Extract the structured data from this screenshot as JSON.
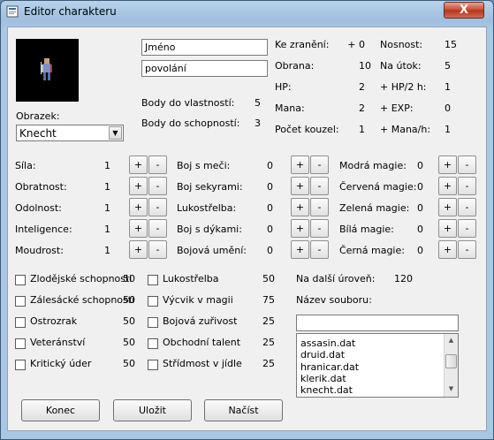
{
  "window": {
    "title": "Editor charakteru",
    "close_label": "X"
  },
  "portrait": {
    "label": "Obrazek:",
    "selected": "Knecht"
  },
  "identity": {
    "name": "Jméno",
    "profession": "povolání"
  },
  "points": [
    {
      "label": "Body do vlastností:",
      "value": "5"
    },
    {
      "label": "Body do schopností:",
      "value": "3"
    }
  ],
  "stats_left": [
    {
      "label": "Ke zranění:",
      "value": "+ 0"
    },
    {
      "label": "Obrana:",
      "value": "10"
    },
    {
      "label": "HP:",
      "value": "2"
    },
    {
      "label": "Mana:",
      "value": "2"
    },
    {
      "label": "Počet kouzel:",
      "value": "1"
    }
  ],
  "stats_right": [
    {
      "label": "Nosnost:",
      "value": "15"
    },
    {
      "label": "Na útok:",
      "value": "5"
    },
    {
      "label": "+ HP/2 h:",
      "value": "1"
    },
    {
      "label": "+ EXP:",
      "value": "0"
    },
    {
      "label": "+ Mana/h:",
      "value": "1"
    }
  ],
  "attributes": [
    {
      "label": "Síla:",
      "value": "1"
    },
    {
      "label": "Obratnost:",
      "value": "1"
    },
    {
      "label": "Odolnost:",
      "value": "1"
    },
    {
      "label": "Inteligence:",
      "value": "1"
    },
    {
      "label": "Moudrost:",
      "value": "1"
    }
  ],
  "combat": [
    {
      "label": "Boj s meči:",
      "value": "0"
    },
    {
      "label": "Boj sekyrami:",
      "value": "0"
    },
    {
      "label": "Lukostřelba:",
      "value": "0"
    },
    {
      "label": "Boj s dýkami:",
      "value": "0"
    },
    {
      "label": "Bojová umění:",
      "value": "0"
    }
  ],
  "magic": [
    {
      "label": "Modrá magie:",
      "value": "0"
    },
    {
      "label": "Červená magie:",
      "value": "0"
    },
    {
      "label": "Zelená magie:",
      "value": "0"
    },
    {
      "label": "Bílá magie:",
      "value": "0"
    },
    {
      "label": "Černá magie:",
      "value": "0"
    }
  ],
  "buttons": {
    "plus": "+",
    "minus": "-"
  },
  "skills_left": [
    {
      "label": "Zlodějské schopnosti",
      "cost": "50"
    },
    {
      "label": "Zálesácké schopnosti",
      "cost": "50"
    },
    {
      "label": "Ostrozrak",
      "cost": "50"
    },
    {
      "label": "Veteránství",
      "cost": "50"
    },
    {
      "label": "Kritický úder",
      "cost": "50"
    }
  ],
  "skills_right": [
    {
      "label": "Lukostřelba",
      "cost": "50"
    },
    {
      "label": "Výcvik v magii",
      "cost": "75"
    },
    {
      "label": "Bojová zuřivost",
      "cost": "25"
    },
    {
      "label": "Obchodní talent",
      "cost": "25"
    },
    {
      "label": "Střídmost v jídle",
      "cost": "25"
    }
  ],
  "level": {
    "label": "Na další úroveň:",
    "value": "120"
  },
  "file": {
    "label": "Název souboru:",
    "value": "",
    "list": [
      "assasin.dat",
      "druid.dat",
      "hranicar.dat",
      "klerik.dat",
      "knecht.dat"
    ]
  },
  "actions": {
    "end": "Konec",
    "save": "Uložit",
    "load": "Načíst"
  }
}
